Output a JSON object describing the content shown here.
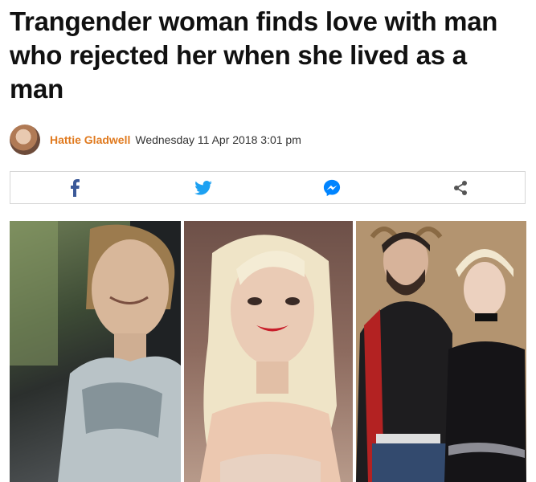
{
  "article": {
    "headline": "Trangender woman finds love with man who rejected her when she lived as a man",
    "author": "Hattie Gladwell",
    "date": "Wednesday 11 Apr 2018 3:01 pm"
  },
  "share": {
    "buttons": [
      {
        "icon": "facebook-icon",
        "color": "#3b5998"
      },
      {
        "icon": "twitter-icon",
        "color": "#1da1f2"
      },
      {
        "icon": "messenger-icon",
        "color": "#0084ff"
      },
      {
        "icon": "share-icon",
        "color": "#555555"
      }
    ]
  },
  "colors": {
    "author": "#e07a1f"
  }
}
